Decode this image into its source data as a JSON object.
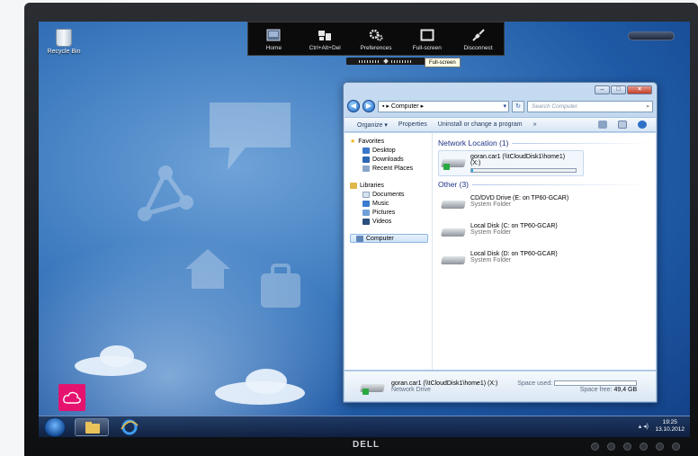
{
  "desktop": {
    "recycle_bin_label": "Recycle Bin"
  },
  "remote_toolbar": {
    "items": [
      {
        "label": "Home",
        "icon": "home-icon"
      },
      {
        "label": "Ctrl+Alt+Del",
        "icon": "keyboard-icon"
      },
      {
        "label": "Preferences",
        "icon": "gears-icon"
      },
      {
        "label": "Full-screen",
        "icon": "fullscreen-icon"
      },
      {
        "label": "Disconnect",
        "icon": "disconnect-icon"
      }
    ],
    "tooltip": "Full-screen"
  },
  "explorer": {
    "address": "Computer",
    "search_placeholder": "Search Computer",
    "commands": [
      "Organize",
      "Properties",
      "Uninstall or change a program",
      "»"
    ],
    "nav": {
      "favorites": "Favorites",
      "fav_items": [
        "Desktop",
        "Downloads",
        "Recent Places"
      ],
      "libraries": "Libraries",
      "lib_items": [
        "Documents",
        "Music",
        "Pictures",
        "Videos"
      ],
      "computer": "Computer"
    },
    "network_group": "Network Location (1)",
    "network_item": {
      "name": "goran.car1 (\\\\tCloudDisk1\\home1)",
      "letter": "(X:)",
      "used_fraction": 0.02
    },
    "other_group": "Other (3)",
    "other_items": [
      {
        "name": "CD/DVD Drive (E: on TP60-GCAR)",
        "type": "System Folder"
      },
      {
        "name": "Local Disk (C: on TP60-GCAR)",
        "type": "System Folder"
      },
      {
        "name": "Local Disk (D: on TP60-GCAR)",
        "type": "System Folder"
      }
    ],
    "details": {
      "name": "goran.car1 (\\\\tCloudDisk1\\home1) (X:)",
      "type": "Network Drive",
      "space_used_label": "Space used:",
      "space_free_label": "Space free:",
      "space_free_value": "49,4 GB"
    }
  },
  "taskbar": {
    "time": "19:25",
    "date": "13.10.2012"
  },
  "monitor": {
    "brand": "DELL"
  },
  "colors": {
    "accent": "#e5136f",
    "desktop": "#2b68b3",
    "explorer_chrome": "#c6dbf1"
  }
}
